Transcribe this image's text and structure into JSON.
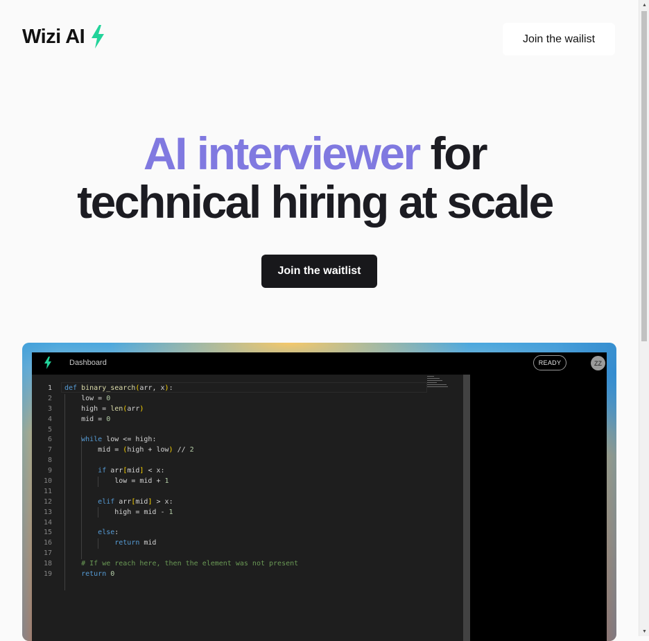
{
  "header": {
    "logo_text": "Wizi AI",
    "logo_icon": "lightning-bolt-icon",
    "waitlist_button": "Join  the wailist"
  },
  "hero": {
    "title_accent": "AI interviewer",
    "title_rest_line1": "for",
    "title_line2": "technical hiring at scale",
    "cta_button": "Join the waitlist"
  },
  "app": {
    "nav_label": "Dashboard",
    "status": "READY",
    "avatar_initials": "ZZ",
    "code_lines": [
      {
        "n": "1",
        "text": "def binary_search(arr, x):"
      },
      {
        "n": "2",
        "text": "    low = 0"
      },
      {
        "n": "3",
        "text": "    high = len(arr)"
      },
      {
        "n": "4",
        "text": "    mid = 0"
      },
      {
        "n": "5",
        "text": ""
      },
      {
        "n": "6",
        "text": "    while low <= high:"
      },
      {
        "n": "7",
        "text": "        mid = (high + low) // 2"
      },
      {
        "n": "8",
        "text": ""
      },
      {
        "n": "9",
        "text": "        if arr[mid] < x:"
      },
      {
        "n": "10",
        "text": "            low = mid + 1"
      },
      {
        "n": "11",
        "text": ""
      },
      {
        "n": "12",
        "text": "        elif arr[mid] > x:"
      },
      {
        "n": "13",
        "text": "            high = mid - 1"
      },
      {
        "n": "14",
        "text": ""
      },
      {
        "n": "15",
        "text": "        else:"
      },
      {
        "n": "16",
        "text": "            return mid"
      },
      {
        "n": "17",
        "text": ""
      },
      {
        "n": "18",
        "text": "    # If we reach here, then the element was not present"
      },
      {
        "n": "19",
        "text": "    return 0"
      }
    ]
  },
  "colors": {
    "accent": "#8079e0",
    "brand_green": "#22d39a",
    "dark_button": "#18181b"
  }
}
